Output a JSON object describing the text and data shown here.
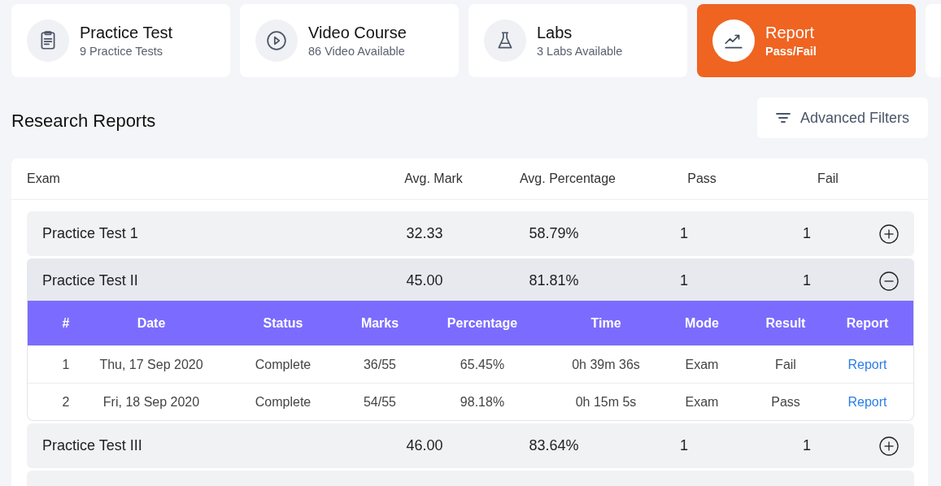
{
  "cards": [
    {
      "kind": "clipboard",
      "title": "Practice Test",
      "subtitle": "9 Practice Tests",
      "selected": false
    },
    {
      "kind": "play",
      "title": "Video Course",
      "subtitle": "86 Video Available",
      "selected": false
    },
    {
      "kind": "flask",
      "title": "Labs",
      "subtitle": "3 Labs Available",
      "selected": false
    },
    {
      "kind": "trend",
      "title": "Report",
      "subtitle": "Pass/Fail",
      "selected": true
    }
  ],
  "heading": "Research Reports",
  "filter_button": "Advanced Filters",
  "table": {
    "columns": [
      "Exam",
      "Avg. Mark",
      "Avg. Percentage",
      "Pass",
      "Fail"
    ],
    "rows": [
      {
        "exam": "Practice Test 1",
        "avg_mark": "32.33",
        "avg_percentage": "58.79%",
        "pass": "1",
        "fail": "1",
        "expanded": false
      },
      {
        "exam": "Practice Test II",
        "avg_mark": "45.00",
        "avg_percentage": "81.81%",
        "pass": "1",
        "fail": "1",
        "expanded": true,
        "detail": {
          "columns": [
            "#",
            "Date",
            "Status",
            "Marks",
            "Percentage",
            "Time",
            "Mode",
            "Result",
            "Report"
          ],
          "rows": [
            {
              "cells": [
                "1",
                "Thu, 17 Sep 2020",
                "Complete",
                "36/55",
                "65.45%",
                "0h 39m 36s",
                "Exam",
                "Fail"
              ],
              "link": "Report"
            },
            {
              "cells": [
                "2",
                "Fri, 18 Sep 2020",
                "Complete",
                "54/55",
                "98.18%",
                "0h 15m 5s",
                "Exam",
                "Pass"
              ],
              "link": "Report"
            }
          ]
        }
      },
      {
        "exam": "Practice Test III",
        "avg_mark": "46.00",
        "avg_percentage": "83.64%",
        "pass": "1",
        "fail": "1",
        "expanded": false
      }
    ]
  }
}
